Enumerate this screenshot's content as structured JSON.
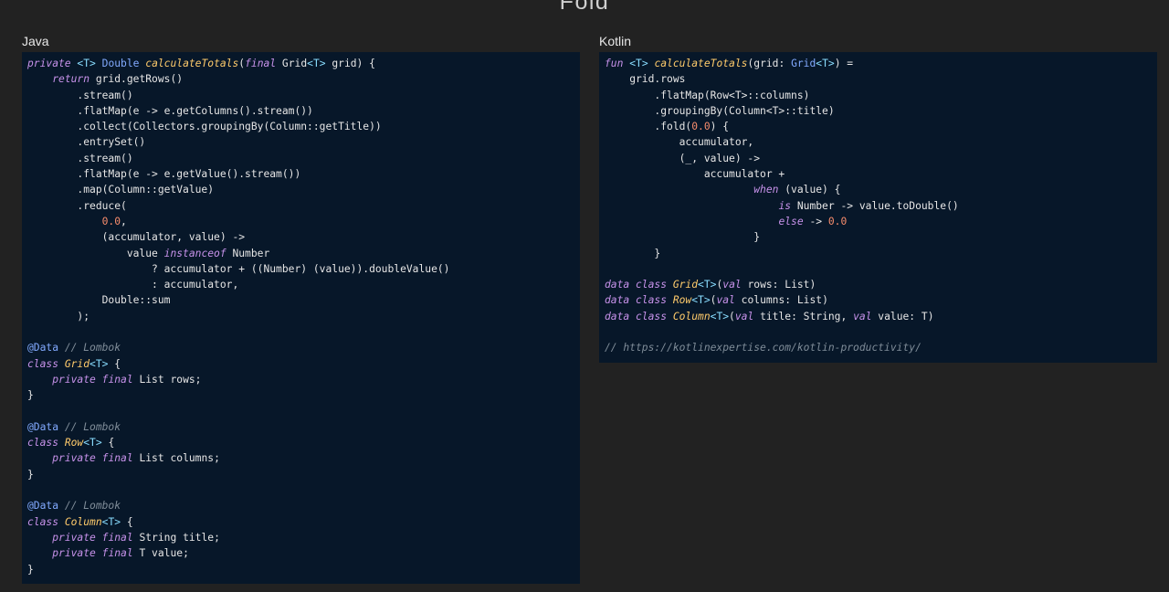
{
  "slide": {
    "title": "Fold"
  },
  "panels": {
    "java": {
      "label": "Java"
    },
    "kotlin": {
      "label": "Kotlin"
    }
  },
  "java_code": [
    [
      [
        "kw",
        "private"
      ],
      [
        "t",
        " "
      ],
      [
        "gt",
        "<T>"
      ],
      [
        "t",
        " "
      ],
      [
        "an",
        "Double"
      ],
      [
        "t",
        " "
      ],
      [
        "fn",
        "calculateTotals"
      ],
      [
        "t",
        "("
      ],
      [
        "kw",
        "final"
      ],
      [
        "t",
        " Grid"
      ],
      [
        "gt",
        "<T>"
      ],
      [
        "t",
        " grid) {"
      ]
    ],
    [
      [
        "t",
        "    "
      ],
      [
        "kw",
        "return"
      ],
      [
        "t",
        " grid.getRows()"
      ]
    ],
    [
      [
        "t",
        "        .stream()"
      ]
    ],
    [
      [
        "t",
        "        .flatMap(e -> e.getColumns().stream())"
      ]
    ],
    [
      [
        "t",
        "        .collect(Collectors.groupingBy(Column::getTitle))"
      ]
    ],
    [
      [
        "t",
        "        .entrySet()"
      ]
    ],
    [
      [
        "t",
        "        .stream()"
      ]
    ],
    [
      [
        "t",
        "        .flatMap(e -> e.getValue().stream())"
      ]
    ],
    [
      [
        "t",
        "        .map(Column::getValue)"
      ]
    ],
    [
      [
        "t",
        "        .reduce("
      ]
    ],
    [
      [
        "t",
        "            "
      ],
      [
        "num",
        "0.0"
      ],
      [
        "t",
        ","
      ]
    ],
    [
      [
        "t",
        "            (accumulator, value) ->"
      ]
    ],
    [
      [
        "t",
        "                value "
      ],
      [
        "kw",
        "instanceof"
      ],
      [
        "t",
        " Number"
      ]
    ],
    [
      [
        "t",
        "                    ? accumulator + ((Number) (value)).doubleValue()"
      ]
    ],
    [
      [
        "t",
        "                    : accumulator,"
      ]
    ],
    [
      [
        "t",
        "            Double::sum"
      ]
    ],
    [
      [
        "t",
        "        );"
      ]
    ],
    [
      [
        "t",
        ""
      ]
    ],
    [
      [
        "an",
        "@Data"
      ],
      [
        "t",
        " "
      ],
      [
        "cm",
        "// Lombok"
      ]
    ],
    [
      [
        "kw",
        "class"
      ],
      [
        "t",
        " "
      ],
      [
        "fn",
        "Grid"
      ],
      [
        "gt",
        "<T>"
      ],
      [
        "t",
        " {"
      ]
    ],
    [
      [
        "t",
        "    "
      ],
      [
        "kw",
        "private"
      ],
      [
        "t",
        " "
      ],
      [
        "kw",
        "final"
      ],
      [
        "t",
        " List rows;"
      ]
    ],
    [
      [
        "t",
        "}"
      ]
    ],
    [
      [
        "t",
        ""
      ]
    ],
    [
      [
        "an",
        "@Data"
      ],
      [
        "t",
        " "
      ],
      [
        "cm",
        "// Lombok"
      ]
    ],
    [
      [
        "kw",
        "class"
      ],
      [
        "t",
        " "
      ],
      [
        "fn",
        "Row"
      ],
      [
        "gt",
        "<T>"
      ],
      [
        "t",
        " {"
      ]
    ],
    [
      [
        "t",
        "    "
      ],
      [
        "kw",
        "private"
      ],
      [
        "t",
        " "
      ],
      [
        "kw",
        "final"
      ],
      [
        "t",
        " List columns;"
      ]
    ],
    [
      [
        "t",
        "}"
      ]
    ],
    [
      [
        "t",
        ""
      ]
    ],
    [
      [
        "an",
        "@Data"
      ],
      [
        "t",
        " "
      ],
      [
        "cm",
        "// Lombok"
      ]
    ],
    [
      [
        "kw",
        "class"
      ],
      [
        "t",
        " "
      ],
      [
        "fn",
        "Column"
      ],
      [
        "gt",
        "<T>"
      ],
      [
        "t",
        " {"
      ]
    ],
    [
      [
        "t",
        "    "
      ],
      [
        "kw",
        "private"
      ],
      [
        "t",
        " "
      ],
      [
        "kw",
        "final"
      ],
      [
        "t",
        " String title;"
      ]
    ],
    [
      [
        "t",
        "    "
      ],
      [
        "kw",
        "private"
      ],
      [
        "t",
        " "
      ],
      [
        "kw",
        "final"
      ],
      [
        "t",
        " T value;"
      ]
    ],
    [
      [
        "t",
        "}"
      ]
    ]
  ],
  "kotlin_code": [
    [
      [
        "kw",
        "fun"
      ],
      [
        "t",
        " "
      ],
      [
        "gt",
        "<T>"
      ],
      [
        "t",
        " "
      ],
      [
        "fn",
        "calculateTotals"
      ],
      [
        "t",
        "(grid: "
      ],
      [
        "an",
        "Grid"
      ],
      [
        "gt",
        "<T>"
      ],
      [
        "t",
        ") ="
      ]
    ],
    [
      [
        "t",
        "    grid.rows"
      ]
    ],
    [
      [
        "t",
        "        .flatMap(Row<T>::columns)"
      ]
    ],
    [
      [
        "t",
        "        .groupingBy(Column<T>::title)"
      ]
    ],
    [
      [
        "t",
        "        .fold("
      ],
      [
        "num",
        "0.0"
      ],
      [
        "t",
        ") {"
      ]
    ],
    [
      [
        "t",
        "            accumulator,"
      ]
    ],
    [
      [
        "t",
        "            (_, value) ->"
      ]
    ],
    [
      [
        "t",
        "                accumulator +"
      ]
    ],
    [
      [
        "t",
        "                        "
      ],
      [
        "kw",
        "when"
      ],
      [
        "t",
        " (value) {"
      ]
    ],
    [
      [
        "t",
        "                            "
      ],
      [
        "kw",
        "is"
      ],
      [
        "t",
        " Number -> value.toDouble()"
      ]
    ],
    [
      [
        "t",
        "                            "
      ],
      [
        "kw",
        "else"
      ],
      [
        "t",
        " -> "
      ],
      [
        "num",
        "0.0"
      ]
    ],
    [
      [
        "t",
        "                        }"
      ]
    ],
    [
      [
        "t",
        "        }"
      ]
    ],
    [
      [
        "t",
        ""
      ]
    ],
    [
      [
        "kw",
        "data class"
      ],
      [
        "t",
        " "
      ],
      [
        "fn",
        "Grid"
      ],
      [
        "gt",
        "<T>"
      ],
      [
        "t",
        "("
      ],
      [
        "kw",
        "val"
      ],
      [
        "t",
        " rows: List)"
      ]
    ],
    [
      [
        "kw",
        "data class"
      ],
      [
        "t",
        " "
      ],
      [
        "fn",
        "Row"
      ],
      [
        "gt",
        "<T>"
      ],
      [
        "t",
        "("
      ],
      [
        "kw",
        "val"
      ],
      [
        "t",
        " columns: List)"
      ]
    ],
    [
      [
        "kw",
        "data class"
      ],
      [
        "t",
        " "
      ],
      [
        "fn",
        "Column"
      ],
      [
        "gt",
        "<T>"
      ],
      [
        "t",
        "("
      ],
      [
        "kw",
        "val"
      ],
      [
        "t",
        " title: String, "
      ],
      [
        "kw",
        "val"
      ],
      [
        "t",
        " value: T)"
      ]
    ],
    [
      [
        "t",
        ""
      ]
    ],
    [
      [
        "cm",
        "// https://kotlinexpertise.com/kotlin-productivity/"
      ]
    ]
  ]
}
